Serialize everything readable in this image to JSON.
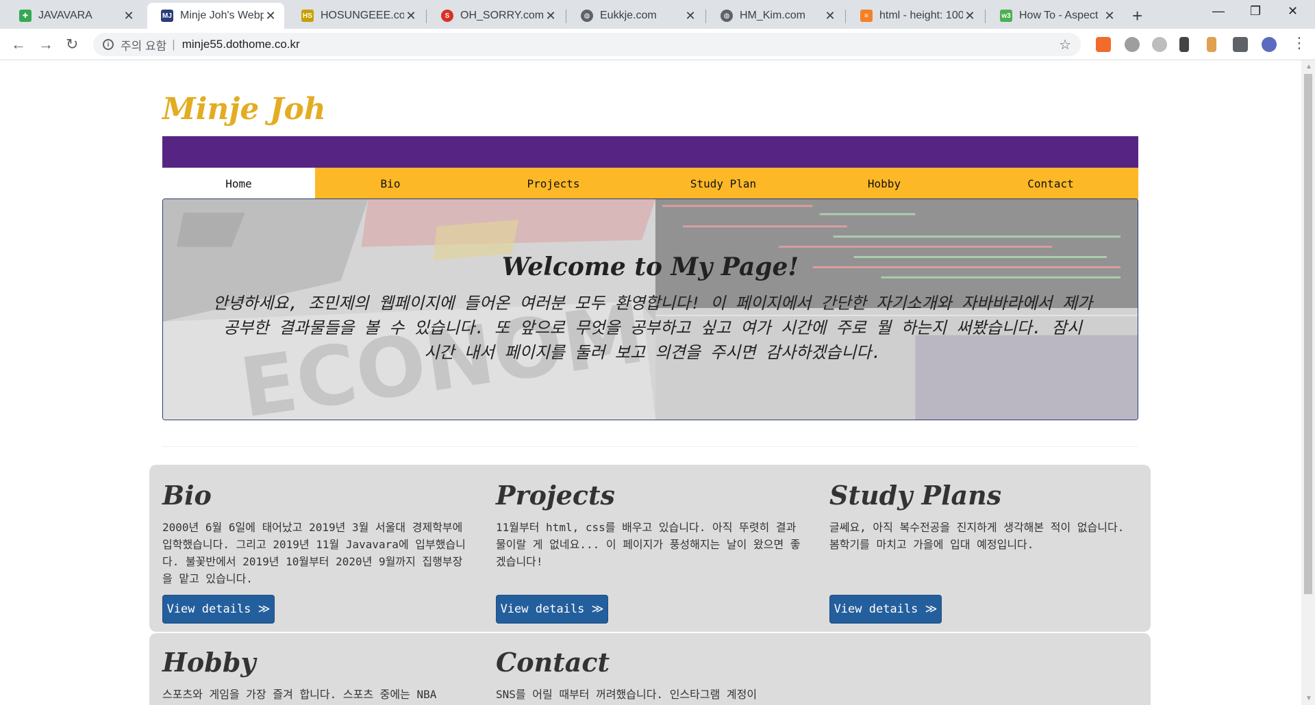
{
  "browser": {
    "tabs": [
      {
        "title": "JAVAVARA",
        "favicon": "javavara-favicon",
        "color": "#34a853",
        "active": false
      },
      {
        "title": "Minje Joh's Webp",
        "favicon": "mj-favicon",
        "color": "#2b3d7a",
        "active": true
      },
      {
        "title": "HOSUNGEEE.com",
        "favicon": "hs-favicon",
        "color": "#c8a000",
        "active": false
      },
      {
        "title": "OH_SORRY.com",
        "favicon": "sorry-favicon",
        "color": "#d93025",
        "active": false
      },
      {
        "title": "Eukkje.com",
        "favicon": "globe-icon",
        "color": "#5f6368",
        "active": false
      },
      {
        "title": "HM_Kim.com",
        "favicon": "globe-icon",
        "color": "#5f6368",
        "active": false
      },
      {
        "title": "html - height: 100",
        "favicon": "stackoverflow-favicon",
        "color": "#f48024",
        "active": false
      },
      {
        "title": "How To - Aspect",
        "favicon": "w3schools-favicon",
        "color": "#4caf50",
        "active": false
      }
    ],
    "security_label": "주의 요함",
    "url": "minje55.dothome.co.kr"
  },
  "site": {
    "title": "Minje Joh",
    "brand_color": "#e4ac22",
    "bar_color": "#562584",
    "menu_color": "#fdb827",
    "menu": [
      "Home",
      "Bio",
      "Projects",
      "Study Plan",
      "Hobby",
      "Contact"
    ],
    "active_menu": "Home"
  },
  "hero": {
    "title": "Welcome to My Page!",
    "text": "안녕하세요, 조민제의 웹페이지에 들어온 여러분 모두 환영합니다! 이 페이지에서 간단한 자기소개와 자바바라에서 제가 공부한 결과물들을 볼 수 있습니다. 또 앞으로 무엇을 공부하고 싶고 여가 시간에 주로 뭘 하는지 써봤습니다. 잠시 시간 내서 페이지를 둘러 보고 의견을 주시면 감사하겠습니다."
  },
  "cards": [
    {
      "title": "Bio",
      "text": "2000년 6월 6일에 태어났고 2019년 3월 서울대 경제학부에 입학했습니다. 그리고 2019년 11월 Javavara에 입부했습니다. 불꽃반에서 2019년 10월부터 2020년 9월까지 집행부장을 맡고 있습니다.",
      "button": "View details ≫"
    },
    {
      "title": "Projects",
      "text": "11월부터 html, css를 배우고 있습니다. 아직 뚜렷히 결과물이랄 게 없네요... 이 페이지가 풍성해지는 날이 왔으면 좋겠습니다!",
      "button": "View details ≫"
    },
    {
      "title": "Study Plans",
      "text": "글쎄요, 아직 복수전공을 진지하게 생각해본 적이 없습니다. 봄학기를 마치고 가을에 입대 예정입니다.",
      "button": "View details ≫"
    },
    {
      "title": "Hobby",
      "text": "스포츠와 게임을 가장 즐겨 합니다. 스포츠 중에는 NBA"
    },
    {
      "title": "Contact",
      "text": "SNS를 어릴 때부터 꺼려했습니다. 인스타그램 계정이"
    }
  ]
}
